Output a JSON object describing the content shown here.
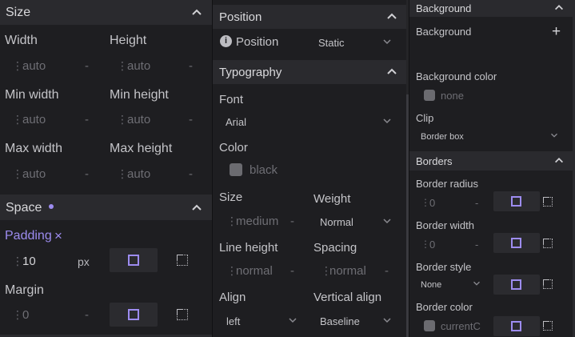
{
  "size": {
    "title": "Size",
    "width_label": "Width",
    "width_value": "auto",
    "width_unit": "-",
    "height_label": "Height",
    "height_value": "auto",
    "height_unit": "-",
    "min_width_label": "Min width",
    "min_width_value": "auto",
    "min_width_unit": "-",
    "min_height_label": "Min height",
    "min_height_value": "auto",
    "min_height_unit": "-",
    "max_width_label": "Max width",
    "max_width_value": "auto",
    "max_width_unit": "-",
    "max_height_label": "Max height",
    "max_height_value": "auto",
    "max_height_unit": "-"
  },
  "space": {
    "title": "Space",
    "padding_label": "Padding",
    "padding_clear": "×",
    "padding_value": "10",
    "padding_unit": "px",
    "margin_label": "Margin",
    "margin_value": "0",
    "margin_unit": "-"
  },
  "position": {
    "title": "Position",
    "label": "Position",
    "value": "Static"
  },
  "typography": {
    "title": "Typography",
    "font_label": "Font",
    "font_value": "Arial",
    "color_label": "Color",
    "color_value": "black",
    "size_label": "Size",
    "size_value": "medium",
    "size_unit": "-",
    "weight_label": "Weight",
    "weight_value": "Normal",
    "line_height_label": "Line height",
    "line_height_value": "normal",
    "line_height_unit": "-",
    "spacing_label": "Spacing",
    "spacing_value": "normal",
    "spacing_unit": "-",
    "align_label": "Align",
    "align_value": "left",
    "vertical_align_label": "Vertical align",
    "vertical_align_value": "Baseline"
  },
  "background": {
    "title": "Background",
    "label": "Background",
    "add": "+",
    "color_label": "Background color",
    "color_value": "none",
    "clip_label": "Clip",
    "clip_value": "Border box"
  },
  "borders": {
    "title": "Borders",
    "radius_label": "Border radius",
    "radius_value": "0",
    "radius_unit": "-",
    "width_label": "Border width",
    "width_value": "0",
    "width_unit": "-",
    "style_label": "Border style",
    "style_value": "None",
    "color_label": "Border color",
    "color_value": "currentColor"
  },
  "colors": {
    "accent": "#9d8cf0",
    "panel": "#1e1e21",
    "header": "#2a2a2e"
  }
}
